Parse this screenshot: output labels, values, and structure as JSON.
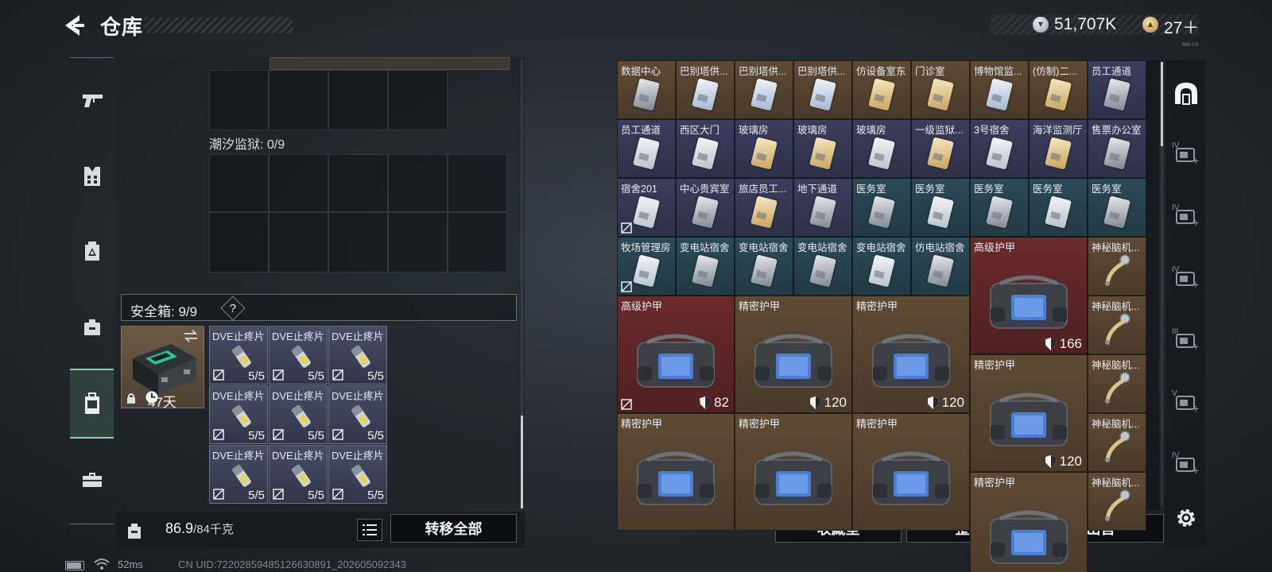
{
  "header": {
    "title": "仓库",
    "money": "51,707K",
    "tokens": "27＋",
    "tiny_text": "888 0.8"
  },
  "icons": {
    "back": "back-arrow-icon",
    "nav": [
      "pistol-icon",
      "vest-icon",
      "backpack-icon",
      "bag-icon",
      "safe-box-icon",
      "toolbox-icon"
    ],
    "right": [
      "arch-icon",
      "iv-add-icon",
      "iv-add-icon",
      "iv-folder-icon",
      "iii-warning-icon",
      "v-money-icon",
      "iv-money-icon",
      "settings-icon"
    ]
  },
  "left": {
    "prison_label": "潮汐监狱: 0/9",
    "safe_label": "安全箱: 9/9",
    "safe_help": "?",
    "safe_days": "47天",
    "meds": [
      {
        "name": "DVE止疼片",
        "count": "5/5"
      },
      {
        "name": "DVE止疼片",
        "count": "5/5"
      },
      {
        "name": "DVE止疼片",
        "count": "5/5"
      },
      {
        "name": "DVE止疼片",
        "count": "5/5"
      },
      {
        "name": "DVE止疼片",
        "count": "5/5"
      },
      {
        "name": "DVE止疼片",
        "count": "5/5"
      },
      {
        "name": "DVE止疼片",
        "count": "5/5"
      },
      {
        "name": "DVE止疼片",
        "count": "5/5"
      },
      {
        "name": "DVE止疼片",
        "count": "5/5"
      }
    ],
    "weight_current": "86.9",
    "weight_max": "/84千克",
    "transfer_all": "转移全部"
  },
  "storage": {
    "cards_row1": [
      "数据中心",
      "巴别塔供...",
      "巴别塔供...",
      "巴别塔供...",
      "仿设备室东",
      "门诊室",
      "博物馆监...",
      "(仿制)二...",
      "员工通道"
    ],
    "cards_row2": [
      "员工通道",
      "西区大门",
      "玻璃房",
      "玻璃房",
      "玻璃房",
      "一级监狱...",
      "3号宿舍",
      "海洋监测厅",
      "售票办公室"
    ],
    "cards_row3": [
      "宿舍201",
      "中心贵宾室",
      "旅店员工...",
      "地下通道",
      "医务室",
      "医务室",
      "医务室",
      "医务室",
      "医务室"
    ],
    "cards_row4": [
      "牧场管理房",
      "变电站宿舍",
      "变电站宿舍",
      "变电站宿舍",
      "变电站宿舍",
      "仿电站宿舍"
    ],
    "armors": [
      {
        "name": "高级护甲",
        "durability": "166"
      },
      {
        "name": "高级护甲",
        "durability": "82"
      },
      {
        "name": "精密护甲",
        "durability": "120"
      },
      {
        "name": "精密护甲",
        "durability": "120"
      },
      {
        "name": "精密护甲",
        "durability": "120"
      },
      {
        "name": "精密护甲",
        "durability": ""
      },
      {
        "name": "精密护甲",
        "durability": ""
      },
      {
        "name": "精密护甲",
        "durability": ""
      },
      {
        "name": "精密护甲",
        "durability": ""
      }
    ],
    "mystery": [
      "神秘脑机...",
      "神秘脑机...",
      "神秘脑机...",
      "神秘脑机...",
      "神秘脑机..."
    ]
  },
  "buttons": {
    "collection": "收藏室",
    "organize": "整理",
    "sell": "出售"
  },
  "status": {
    "ping": "52ms",
    "uid": "CN UID:7220285948512663089​1_202605092343"
  },
  "colors": {
    "brown": "#5f4a34",
    "navy": "#3a3e5c",
    "teal": "#2b4a57",
    "red": "#6a2a2c",
    "accent_green": "#8fd0b0"
  }
}
